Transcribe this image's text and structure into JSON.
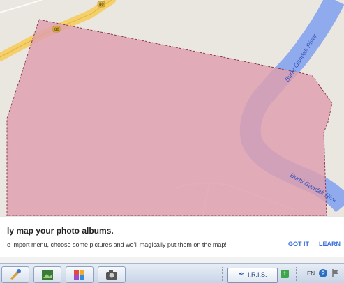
{
  "map": {
    "river_label_1": "Burhi Gandak River",
    "river_label_2": "Burhi Gandak Rive",
    "highway_marker_1": "80",
    "highway_marker_2": "80",
    "colors": {
      "polygon_fill": "#df9fae",
      "polygon_stroke": "#8a3a4e",
      "river": "#8aa8ee",
      "road": "#f4cf6a",
      "land": "#e9e7df"
    }
  },
  "banner": {
    "title": "ly map your photo albums.",
    "text": "e import menu, choose some pictures and we'll magically put them on the map!",
    "got_it": "GOT IT",
    "learn": "LEARN"
  },
  "taskbar": {
    "apps": [
      "paint-icon",
      "picture-icon",
      "colorful-app-icon",
      "camera-icon"
    ],
    "iris_label": "I.R.I.S.",
    "tray_lang": "EN",
    "tray_help": "?"
  }
}
